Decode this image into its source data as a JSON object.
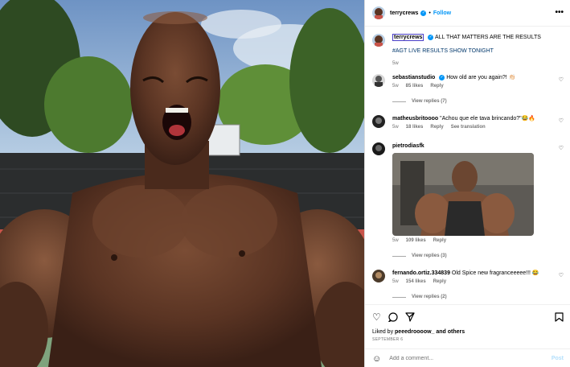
{
  "post": {
    "author": "terrycrews",
    "follow_label": "Follow",
    "more_glyph": "•••",
    "caption_line1": "ALL THAT MATTERS ARE THE RESULTS",
    "caption_line2": "#AGT LIVE RESULTS SHOW TONIGHT",
    "caption_time": "5w"
  },
  "comments": [
    {
      "user": "sebastianstudio",
      "verified": true,
      "text": "How old are you again?! 👏🏻",
      "time": "5w",
      "likes": "85 likes",
      "reply_label": "Reply",
      "view_replies": "View replies (7)"
    },
    {
      "user": "matheusbritoooo",
      "verified": false,
      "text": "\"Achou que ele tava brincando?\"😂🔥",
      "time": "5w",
      "likes": "18 likes",
      "reply_label": "Reply",
      "see_translation": "See translation"
    },
    {
      "user": "pietrodiasfk",
      "verified": false,
      "text": "",
      "time": "5w",
      "likes": "109 likes",
      "reply_label": "Reply",
      "view_replies": "View replies (3)"
    },
    {
      "user": "fernando.ortiz.334839",
      "verified": false,
      "text": "Old Spice new fragranceeeee!!! 😂",
      "time": "5w",
      "likes": "154 likes",
      "reply_label": "Reply",
      "view_replies": "View replies (2)"
    }
  ],
  "footer": {
    "liked_by_prefix": "Liked by ",
    "liked_by_user": "peeedroooow_",
    "liked_by_suffix": " and others",
    "date": "SEPTEMBER 6",
    "comment_placeholder": "Add a comment...",
    "post_label": "Post"
  },
  "icons": [
    "heart-icon",
    "comment-icon",
    "share-icon",
    "save-icon",
    "emoji-icon",
    "more-icon",
    "verified-icon"
  ],
  "colors": {
    "accent": "#0095f6",
    "muted": "#737373",
    "post_disabled": "#b2dffc",
    "hashtag": "#00376b"
  }
}
